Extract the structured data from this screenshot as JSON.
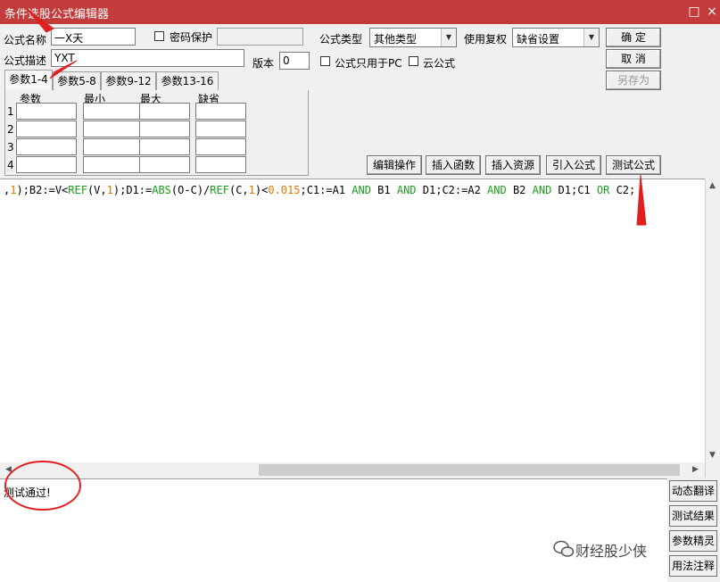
{
  "window": {
    "title": "条件选股公式编辑器",
    "minimize_glyph": "□",
    "close_glyph": "×"
  },
  "form": {
    "name_label": "公式名称",
    "name_value": "一X天",
    "password_label": "密码保护",
    "description_label": "公式描述",
    "description_value": "YXT",
    "version_label": "版本",
    "version_value": "0",
    "pc_only_label": "公式只用于PC",
    "cloud_label": "云公式",
    "type_label": "公式类型",
    "type_value": "其他类型",
    "restore_label": "使用复权",
    "restore_value": "缺省设置"
  },
  "buttons": {
    "ok": "确 定",
    "cancel": "取 消",
    "save_as": "另存为",
    "edit_ops": "编辑操作",
    "insert_func": "插入函数",
    "insert_res": "插入资源",
    "import_formula": "引入公式",
    "test_formula": "测试公式"
  },
  "tabs": [
    "参数1-4",
    "参数5-8",
    "参数9-12",
    "参数13-16"
  ],
  "params": {
    "headers": [
      "参数",
      "最小",
      "最大",
      "缺省"
    ],
    "rows": [
      "1",
      "2",
      "3",
      "4"
    ]
  },
  "code": [
    {
      "t": ",",
      "c": "#000000"
    },
    {
      "t": "1",
      "c": "#e07a00"
    },
    {
      "t": ");B2:=V<",
      "c": "#000000"
    },
    {
      "t": "REF",
      "c": "#1a9e1a"
    },
    {
      "t": "(V,",
      "c": "#000000"
    },
    {
      "t": "1",
      "c": "#e07a00"
    },
    {
      "t": ");D1:=",
      "c": "#000000"
    },
    {
      "t": "ABS",
      "c": "#1a9e1a"
    },
    {
      "t": "(O-C)/",
      "c": "#000000"
    },
    {
      "t": "REF",
      "c": "#1a9e1a"
    },
    {
      "t": "(C,",
      "c": "#000000"
    },
    {
      "t": "1",
      "c": "#e07a00"
    },
    {
      "t": ")<",
      "c": "#000000"
    },
    {
      "t": "0.015",
      "c": "#e07a00"
    },
    {
      "t": ";C1:=A1 ",
      "c": "#000000"
    },
    {
      "t": "AND",
      "c": "#1a9e1a"
    },
    {
      "t": " B1 ",
      "c": "#000000"
    },
    {
      "t": "AND",
      "c": "#1a9e1a"
    },
    {
      "t": " D1;C2:=A2 ",
      "c": "#000000"
    },
    {
      "t": "AND",
      "c": "#1a9e1a"
    },
    {
      "t": " B2 ",
      "c": "#000000"
    },
    {
      "t": "AND",
      "c": "#1a9e1a"
    },
    {
      "t": " D1;C1 ",
      "c": "#000000"
    },
    {
      "t": "OR",
      "c": "#1a9e1a"
    },
    {
      "t": " C2;",
      "c": "#000000"
    }
  ],
  "output": {
    "message": "测试通过!"
  },
  "side_buttons": [
    "动态翻译",
    "测试结果",
    "参数精灵",
    "用法注释"
  ],
  "watermark": "财经股少侠",
  "icons": {
    "minimize": "restore-icon",
    "close": "close-icon",
    "dropdown": "chevron-down-icon",
    "wechat": "wechat-icon"
  },
  "colors": {
    "titlebar": "#c43b3b",
    "keyword": "#1a9e1a",
    "number": "#e07a00",
    "annotation": "#e02020"
  }
}
